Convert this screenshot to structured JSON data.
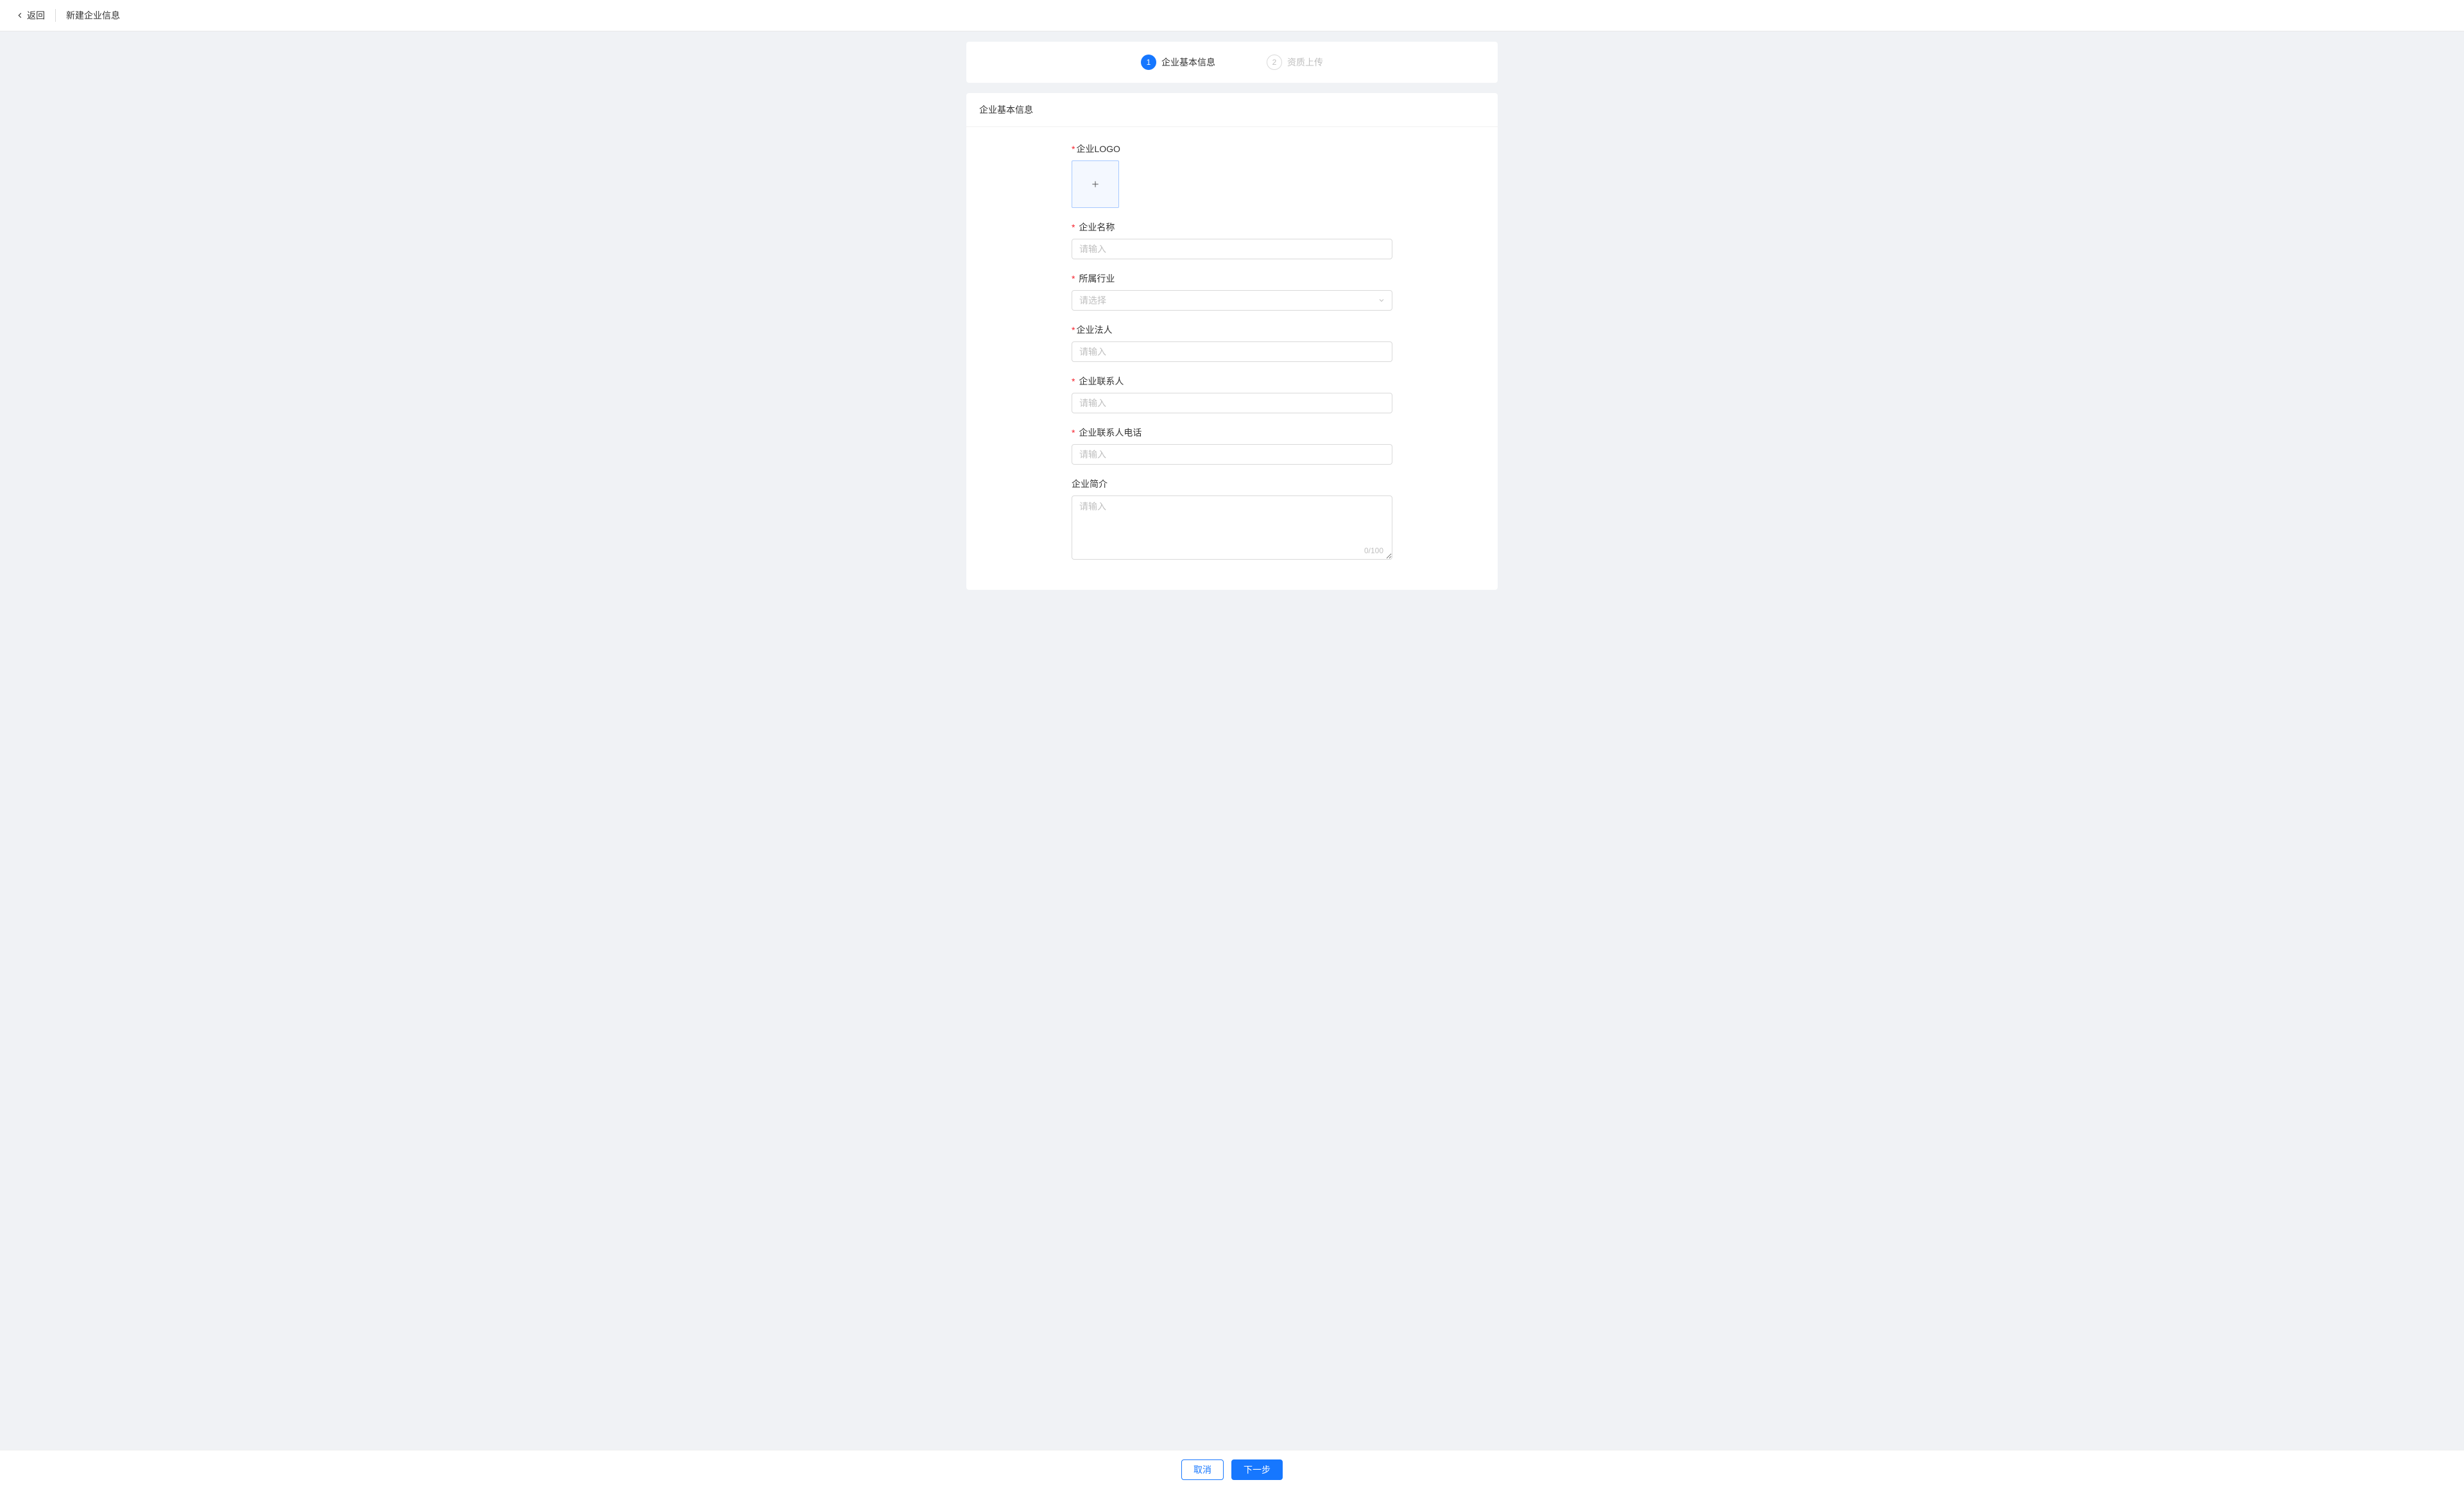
{
  "header": {
    "back": "返回",
    "title": "新建企业信息"
  },
  "steps": {
    "step1": {
      "num": "1",
      "label": "企业基本信息"
    },
    "step2": {
      "num": "2",
      "label": "资质上传"
    }
  },
  "form": {
    "section_title": "企业基本信息",
    "logo": {
      "label": "企业LOGO"
    },
    "name": {
      "label": "企业名称",
      "placeholder": "请输入"
    },
    "industry": {
      "label": "所属行业",
      "placeholder": "请选择"
    },
    "legal": {
      "label": "企业法人",
      "placeholder": "请输入"
    },
    "contact": {
      "label": "企业联系人",
      "placeholder": "请输入"
    },
    "phone": {
      "label": "企业联系人电话",
      "placeholder": "请输入"
    },
    "intro": {
      "label": "企业简介",
      "placeholder": "请输入",
      "counter": "0/100"
    }
  },
  "footer": {
    "cancel": "取消",
    "next": "下一步"
  }
}
